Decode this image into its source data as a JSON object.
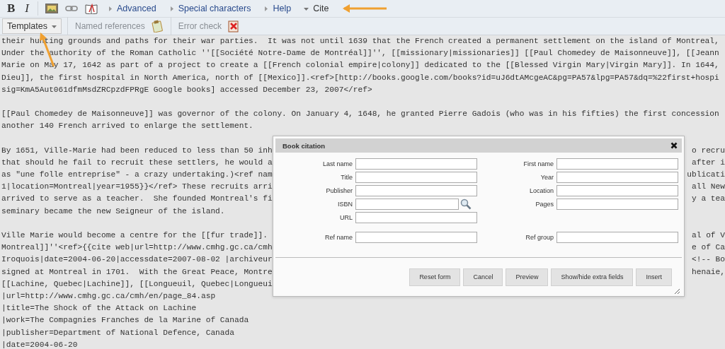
{
  "toolbar": {
    "format_buttons": [
      {
        "label": "B",
        "kind": "bold"
      },
      {
        "label": "I",
        "kind": "italic"
      }
    ],
    "menus": [
      {
        "label": "Advanced",
        "expanded": false
      },
      {
        "label": "Special characters",
        "expanded": false
      },
      {
        "label": "Help",
        "expanded": false
      },
      {
        "label": "Cite",
        "expanded": true
      }
    ]
  },
  "subtoolbar": {
    "dropdown": {
      "label": "Templates"
    },
    "tools": [
      {
        "label": "Named references",
        "kind": "clipboard"
      },
      {
        "label": "Error check",
        "kind": "error"
      }
    ]
  },
  "editor": {
    "paragraphs": [
      [
        {
          "text": "their hunting grounds and paths for their war parties.  It was not until 1639 that the French created a permanent settlement on the island of Montreal,"
        },
        {
          "text": "Under the authority of the Roman Catholic ''[[Société Notre-Dame de Montréal]]'', [[missionary|missionaries]] [[Paul Chomedey de Maisonneuve]], [[Jeann"
        },
        {
          "text": "Marie on May 17, 1642 as part of a project to create a [[French colonial empire|colony]] dedicated to the [[Blessed Virgin Mary|Virgin Mary]]. In 1644,"
        },
        {
          "text": "Dieu]], the first hospital in North America, north of [[Mexico]].<ref>[http://books.google.com/books?id=uJ6dtAMcgeAC&pg=PA57&lpg=PA57&dq=%22first+hospi"
        },
        {
          "text": "sig=KmA5Aut061dfmMsdZRCpzdFPRgE Google books] accessed December 23, 2007</ref>"
        }
      ],
      [
        {
          "text": "[[Paul Chomedey de Maisonneuve]] was governor of the colony. On January 4, 1648, he granted Pierre Gadois (who was in his fifties) the first concession"
        },
        {
          "text": "another 140 French arrived to enlarge the settlement."
        }
      ],
      [
        {
          "text": "By 1651, Ville-Marie had been reduced to less than 50 inh",
          "continued": "o recru"
        },
        {
          "text": "that should he fail to recruit these settlers, he would a",
          "continued": "after i"
        },
        {
          "text": "as \"une folle entreprise\" - a crazy undertaking.)<ref nam",
          "continued": "ublicati"
        },
        {
          "text": "1|location=Montreal|year=1955}}</ref> These recruits arri",
          "continued": "all New"
        },
        {
          "text": "arrived to serve as a teacher.  She founded Montreal's fi",
          "continued": "y a tea"
        },
        {
          "text": "seminary became the new Seigneur of the island."
        }
      ],
      [
        {
          "text": "Ville Marie would become a centre for the [[fur trade]].",
          "continued": "al of V"
        },
        {
          "text": "Montreal]]''<ref>{{cite web|url=http://www.cmhg.gc.ca/cmh",
          "continued": "e of Ca"
        },
        {
          "text": "Iroquois|date=2004-06-20|accessdate=2007-08-02 |archiveur",
          "continued": "<!-- Bo"
        },
        {
          "text": "signed at Montreal in 1701.  With the Great Peace, Montre",
          "continued": "henaie,"
        },
        {
          "text": "[[Lachine, Quebec|Lachine]], [[Longueuil, Quebec|Longueui"
        },
        {
          "text": "|url=http://www.cmhg.gc.ca/cmh/en/page_84.asp"
        },
        {
          "text": "|title=The Shock of the Attack on Lachine"
        },
        {
          "text": "|work=The Compagnies Franches de la Marine of Canada"
        },
        {
          "text": "|publisher=Department of National Defence, Canada"
        },
        {
          "text": "|date=2004-06-20"
        }
      ]
    ]
  },
  "dialog": {
    "title": "Book citation",
    "field_groups": [
      [
        [
          {
            "label": "Last name",
            "lookup": false
          },
          {
            "label": "First name",
            "lookup": false
          }
        ],
        [
          {
            "label": "Title",
            "lookup": false
          },
          {
            "label": "Year",
            "lookup": false
          }
        ],
        [
          {
            "label": "Publisher",
            "lookup": false
          },
          {
            "label": "Location",
            "lookup": false
          }
        ],
        [
          {
            "label": "ISBN",
            "lookup": true
          },
          {
            "label": "Pages",
            "lookup": false
          }
        ],
        [
          {
            "label": "URL",
            "lookup": false
          }
        ]
      ],
      [
        [
          {
            "label": "Ref name",
            "lookup": false
          },
          {
            "label": "Ref group",
            "lookup": false
          }
        ]
      ]
    ],
    "buttons": [
      "Reset form",
      "Cancel",
      "Preview",
      "Show/hide extra fields",
      "Insert"
    ]
  }
}
